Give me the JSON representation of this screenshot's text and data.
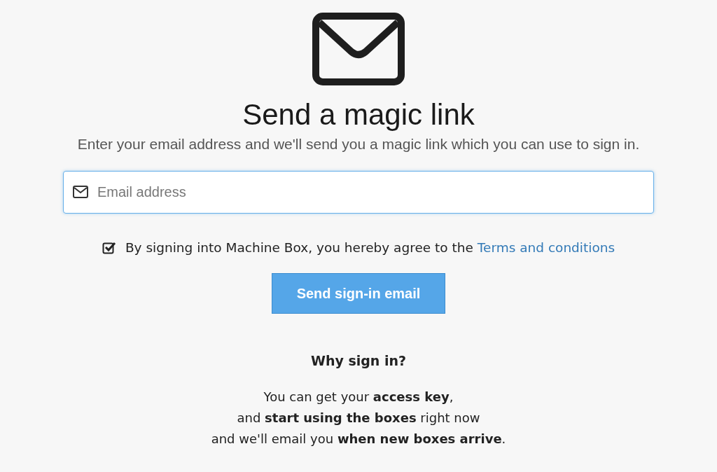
{
  "title": "Send a magic link",
  "subtitle": "Enter your email address and we'll send you a magic link which you can use to sign in.",
  "email_field": {
    "placeholder": "Email address"
  },
  "agreement": {
    "checked": true,
    "text": "By signing into Machine Box, you hereby agree to the",
    "link": "Terms and conditions"
  },
  "submit_button": "Send sign-in email",
  "why": {
    "heading": "Why sign in?",
    "lines": [
      "You can get your **access key**,",
      "and **start using the boxes** right now",
      "and we'll email you **when new boxes arrive**."
    ]
  }
}
